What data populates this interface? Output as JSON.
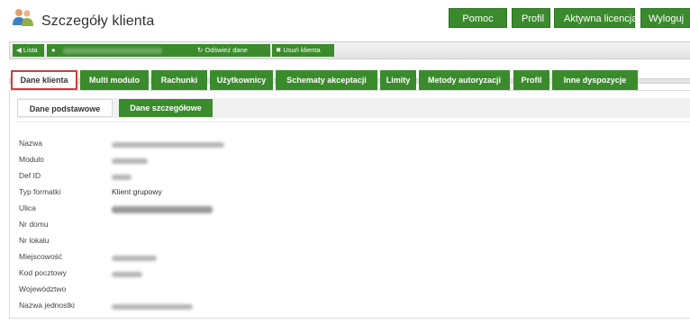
{
  "header": {
    "title": "Szczegóły klienta",
    "nav": [
      "Pomoc",
      "Profil",
      "Aktywna licencja",
      "Wyloguj"
    ]
  },
  "actions": {
    "list_label": "Lista",
    "refresh_label": "Odśwież dane",
    "delete_label": "Usuń klienta"
  },
  "tabs": [
    {
      "label": "Dane klienta",
      "active": true
    },
    {
      "label": "Multi modulo"
    },
    {
      "label": "Rachunki"
    },
    {
      "label": "Użytkownicy"
    },
    {
      "label": "Schematy akceptacji"
    },
    {
      "label": "Limity"
    },
    {
      "label": "Metody autoryzacji"
    },
    {
      "label": "Profil"
    },
    {
      "label": "Inne dyspozycje"
    }
  ],
  "subtabs": [
    {
      "label": "Dane podstawowe",
      "active": true
    },
    {
      "label": "Dane szczegółowe"
    }
  ],
  "fields": [
    {
      "label": "Nazwa",
      "value": ""
    },
    {
      "label": "Modulo",
      "value": ""
    },
    {
      "label": "Def ID",
      "value": ""
    },
    {
      "label": "Typ formatki",
      "value": "Klient grupowy"
    },
    {
      "label": "Ulica",
      "value": ""
    },
    {
      "label": "Nr domu",
      "value": ""
    },
    {
      "label": "Nr lokalu",
      "value": ""
    },
    {
      "label": "Miejscowość",
      "value": ""
    },
    {
      "label": "Kod pocztowy",
      "value": ""
    },
    {
      "label": "Województwo",
      "value": ""
    },
    {
      "label": "Nazwa jednostki",
      "value": ""
    }
  ],
  "colors": {
    "accent_green": "#3a8b2c",
    "active_tab_border": "#d23a3a"
  }
}
